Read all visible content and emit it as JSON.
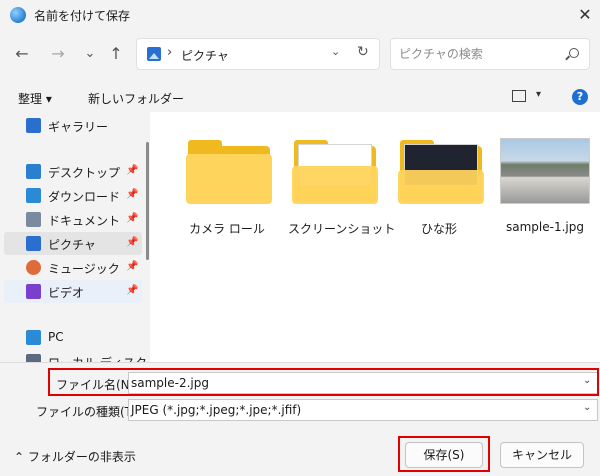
{
  "window": {
    "title": "名前を付けて保存",
    "close_glyph": "✕"
  },
  "nav": {
    "back": "←",
    "forward": "→",
    "recent": "⌄",
    "up": "↑"
  },
  "address": {
    "separator": "›",
    "path": "ピクチャ",
    "dropdown": "⌄",
    "refresh": "↻"
  },
  "search": {
    "placeholder": "ピクチャの検索"
  },
  "toolbar": {
    "organize_label": "整理 ▾",
    "new_folder_label": "新しいフォルダー",
    "view_dropdown": "▾",
    "help_glyph": "?"
  },
  "sidebar": {
    "items": [
      {
        "label": "ギャラリー",
        "icon": "gallery-icon",
        "color": "#2a6fd0"
      },
      {
        "label": "デスクトップ",
        "icon": "desktop-icon",
        "color": "#2a7fd0",
        "pinned": true
      },
      {
        "label": "ダウンロード",
        "icon": "download-icon",
        "color": "#2a8ad6",
        "pinned": true
      },
      {
        "label": "ドキュメント",
        "icon": "document-icon",
        "color": "#7a8aa0",
        "pinned": true
      },
      {
        "label": "ピクチャ",
        "icon": "pictures-icon",
        "color": "#2a6fd0",
        "pinned": true,
        "selected": true
      },
      {
        "label": "ミュージック",
        "icon": "music-icon",
        "color": "#e06b3a",
        "pinned": true
      },
      {
        "label": "ビデオ",
        "icon": "video-icon",
        "color": "#7b3fd0",
        "pinned": true
      },
      {
        "label": "PC",
        "icon": "pc-icon",
        "color": "#2a8ad6"
      },
      {
        "label": "ローカル ディスク",
        "icon": "disk-icon",
        "color": "#5a6a80"
      }
    ],
    "pin_glyph": "📌"
  },
  "files": [
    {
      "name": "カメラ ロール",
      "type": "folder"
    },
    {
      "name": "スクリーンショット",
      "type": "folder"
    },
    {
      "name": "ひな形",
      "type": "folder"
    },
    {
      "name": "sample-1.jpg",
      "type": "image"
    }
  ],
  "form": {
    "filename_label": "ファイル名(N):",
    "filename_value": "sample-2.jpg",
    "filetype_label": "ファイルの種類(T):",
    "filetype_value": "JPEG (*.jpg;*.jpeg;*.jpe;*.jfif)",
    "dropdown": "⌄"
  },
  "footer": {
    "toggle_label": "⌃ フォルダーの非表示",
    "save_label": "保存(S)",
    "cancel_label": "キャンセル"
  },
  "colors": {
    "highlight": "#e00000",
    "accent": "#1f6fd1",
    "folder": "#f0b91f"
  }
}
